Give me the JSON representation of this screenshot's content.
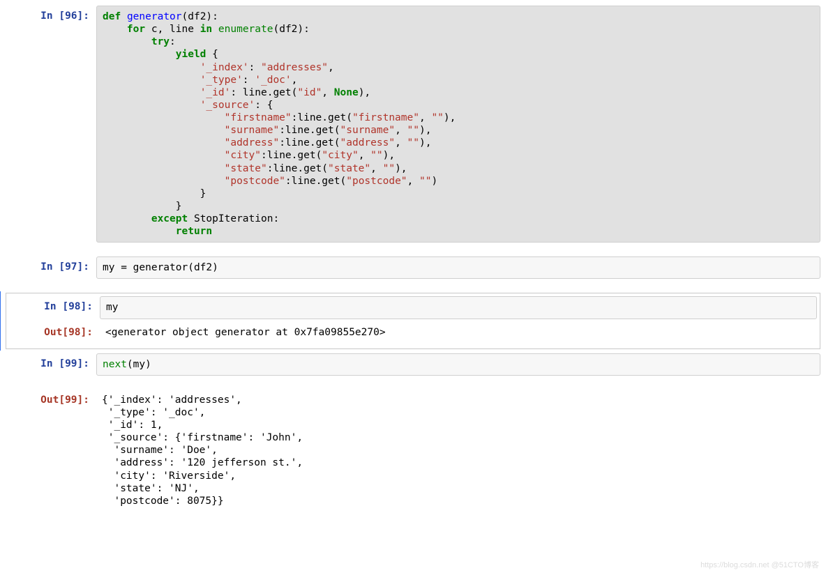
{
  "cells": [
    {
      "kind": "in",
      "n": "96",
      "highlighted": true,
      "tokens": [
        {
          "c": "kw",
          "t": "def"
        },
        {
          "t": " "
        },
        {
          "c": "fn",
          "t": "generator"
        },
        {
          "t": "(df2):"
        },
        {
          "t": "\n    "
        },
        {
          "c": "kw",
          "t": "for"
        },
        {
          "t": " c, line "
        },
        {
          "c": "kw",
          "t": "in"
        },
        {
          "t": " "
        },
        {
          "c": "bi",
          "t": "enumerate"
        },
        {
          "t": "(df2):"
        },
        {
          "t": "\n        "
        },
        {
          "c": "kw",
          "t": "try"
        },
        {
          "t": ":"
        },
        {
          "t": "\n            "
        },
        {
          "c": "kw",
          "t": "yield"
        },
        {
          "t": " {"
        },
        {
          "t": "\n                "
        },
        {
          "c": "str",
          "t": "'_index'"
        },
        {
          "t": ": "
        },
        {
          "c": "str",
          "t": "\"addresses\""
        },
        {
          "t": ","
        },
        {
          "t": "\n                "
        },
        {
          "c": "str",
          "t": "'_type'"
        },
        {
          "t": ": "
        },
        {
          "c": "str",
          "t": "'_doc'"
        },
        {
          "t": ","
        },
        {
          "t": "\n                "
        },
        {
          "c": "str",
          "t": "'_id'"
        },
        {
          "t": ": line.get("
        },
        {
          "c": "str",
          "t": "\"id\""
        },
        {
          "t": ", "
        },
        {
          "c": "nm",
          "t": "None"
        },
        {
          "t": "),"
        },
        {
          "t": "\n                "
        },
        {
          "c": "str",
          "t": "'_source'"
        },
        {
          "t": ": {"
        },
        {
          "t": "\n                    "
        },
        {
          "c": "str",
          "t": "\"firstname\""
        },
        {
          "t": ":line.get("
        },
        {
          "c": "str",
          "t": "\"firstname\""
        },
        {
          "t": ", "
        },
        {
          "c": "str",
          "t": "\"\""
        },
        {
          "t": "),"
        },
        {
          "t": "\n                    "
        },
        {
          "c": "str",
          "t": "\"surname\""
        },
        {
          "t": ":line.get("
        },
        {
          "c": "str",
          "t": "\"surname\""
        },
        {
          "t": ", "
        },
        {
          "c": "str",
          "t": "\"\""
        },
        {
          "t": "),"
        },
        {
          "t": "\n                    "
        },
        {
          "c": "str",
          "t": "\"address\""
        },
        {
          "t": ":line.get("
        },
        {
          "c": "str",
          "t": "\"address\""
        },
        {
          "t": ", "
        },
        {
          "c": "str",
          "t": "\"\""
        },
        {
          "t": "),"
        },
        {
          "t": "\n                    "
        },
        {
          "c": "str",
          "t": "\"city\""
        },
        {
          "t": ":line.get("
        },
        {
          "c": "str",
          "t": "\"city\""
        },
        {
          "t": ", "
        },
        {
          "c": "str",
          "t": "\"\""
        },
        {
          "t": "),"
        },
        {
          "t": "\n                    "
        },
        {
          "c": "str",
          "t": "\"state\""
        },
        {
          "t": ":line.get("
        },
        {
          "c": "str",
          "t": "\"state\""
        },
        {
          "t": ", "
        },
        {
          "c": "str",
          "t": "\"\""
        },
        {
          "t": "),"
        },
        {
          "t": "\n                    "
        },
        {
          "c": "str",
          "t": "\"postcode\""
        },
        {
          "t": ":line.get("
        },
        {
          "c": "str",
          "t": "\"postcode\""
        },
        {
          "t": ", "
        },
        {
          "c": "str",
          "t": "\"\""
        },
        {
          "t": ")"
        },
        {
          "t": "\n                }"
        },
        {
          "t": "\n            }"
        },
        {
          "t": "\n        "
        },
        {
          "c": "kw",
          "t": "except"
        },
        {
          "t": " StopIteration:"
        },
        {
          "t": "\n            "
        },
        {
          "c": "kw",
          "t": "return"
        }
      ]
    },
    {
      "kind": "in",
      "n": "97",
      "tokens": [
        {
          "t": "my = generator(df2)"
        }
      ]
    },
    {
      "kind": "in",
      "n": "98",
      "selected": true,
      "tokens": [
        {
          "t": "my"
        }
      ]
    },
    {
      "kind": "out",
      "n": "98",
      "selected": true,
      "text": "<generator object generator at 0x7fa09855e270>"
    },
    {
      "kind": "in",
      "n": "99",
      "tokens": [
        {
          "c": "bi",
          "t": "next"
        },
        {
          "t": "(my)"
        }
      ]
    },
    {
      "kind": "out",
      "n": "99",
      "text": "{'_index': 'addresses',\n '_type': '_doc',\n '_id': 1,\n '_source': {'firstname': 'John',\n  'surname': 'Doe',\n  'address': '120 jefferson st.',\n  'city': 'Riverside',\n  'state': 'NJ',\n  'postcode': 8075}}"
    }
  ],
  "prompt_labels": {
    "in": "In [",
    "out": "Out[",
    "close": "]:"
  },
  "watermark": "https://blog.csdn.net @51CTO博客"
}
